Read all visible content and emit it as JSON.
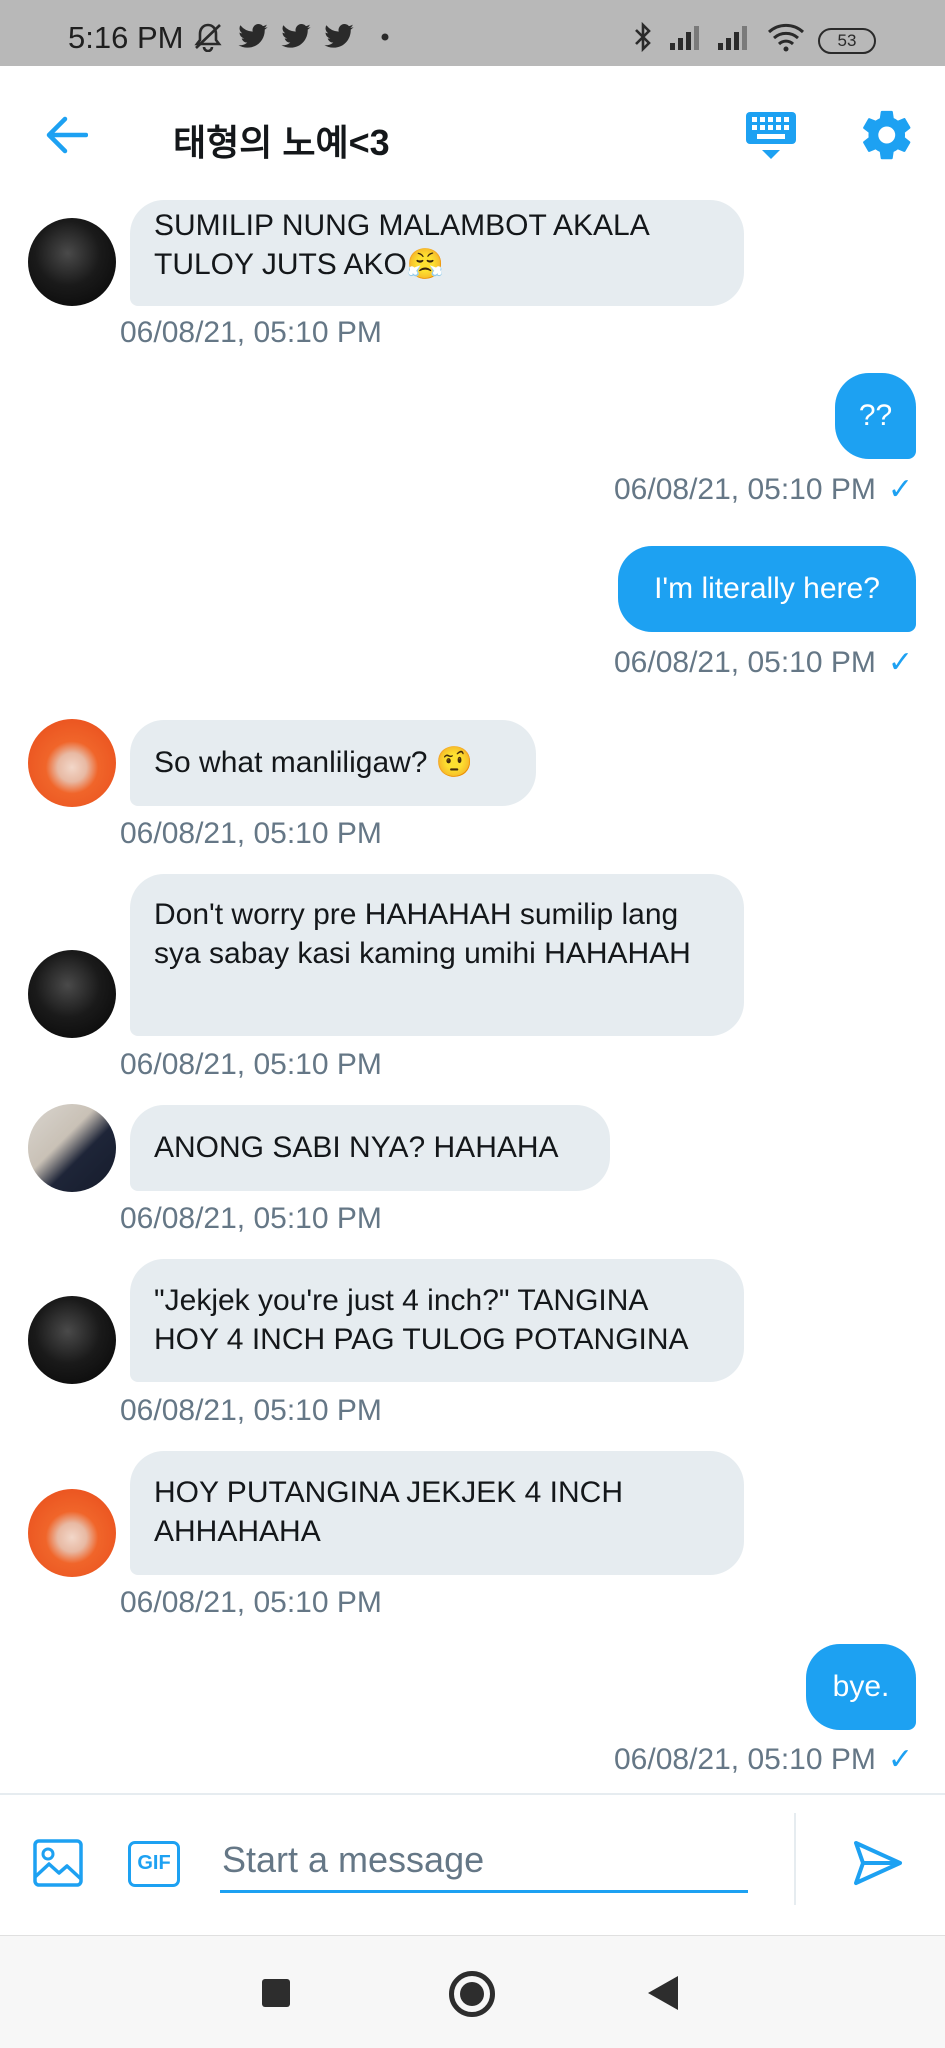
{
  "status_bar": {
    "time": "5:16 PM",
    "battery": "53",
    "icons": [
      "muted-bell-icon",
      "twitter-icon",
      "twitter-icon",
      "twitter-icon",
      "dot-icon",
      "bluetooth-icon",
      "signal-icon",
      "signal-icon",
      "wifi-icon",
      "battery-icon"
    ]
  },
  "header": {
    "title": "태형의 노예<3",
    "back_icon": "arrow-left-icon",
    "keyboard_icon": "keyboard-icon",
    "settings_icon": "gear-icon"
  },
  "messages": [
    {
      "dir": "in",
      "avatar": "dark",
      "text": "SUMILIP NUNG MALAMBOT AKALA TULOY JUTS AKO😤",
      "time": "06/08/21, 05:10 PM"
    },
    {
      "dir": "out",
      "text": "??",
      "time": "06/08/21, 05:10 PM",
      "check": "✓"
    },
    {
      "dir": "out",
      "text": "I'm literally here?",
      "time": "06/08/21, 05:10 PM",
      "check": "✓"
    },
    {
      "dir": "in",
      "avatar": "orange",
      "text": "So what manliligaw? 🤨",
      "time": "06/08/21, 05:10 PM"
    },
    {
      "dir": "in",
      "avatar": "dark",
      "text": "Don't worry pre HAHAHAH sumilip lang sya sabay kasi kaming umihi HAHAHAH",
      "time": "06/08/21, 05:10 PM"
    },
    {
      "dir": "in",
      "avatar": "man",
      "text": "ANONG SABI NYA? HAHAHA",
      "time": "06/08/21, 05:10 PM"
    },
    {
      "dir": "in",
      "avatar": "dark",
      "text": "\"Jekjek you're just 4 inch?\" TANGINA HOY 4 INCH PAG TULOG POTANGINA",
      "time": "06/08/21, 05:10 PM"
    },
    {
      "dir": "in",
      "avatar": "orange",
      "text": "HOY PUTANGINA JEKJEK 4 INCH AHHAHAHA",
      "time": "06/08/21, 05:10 PM"
    },
    {
      "dir": "out",
      "text": "bye.",
      "time": "06/08/21, 05:10 PM",
      "check": "✓"
    }
  ],
  "composer": {
    "placeholder": "Start a message",
    "gif_label": "GIF",
    "image_icon": "image-icon",
    "send_icon": "send-icon"
  },
  "colors": {
    "accent": "#1da1f2",
    "incoming_bubble": "#e6ecf0",
    "timestamp": "#657786"
  }
}
